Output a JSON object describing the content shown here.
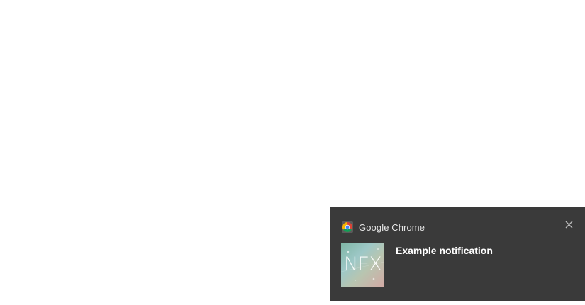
{
  "notification": {
    "app_name": "Google Chrome",
    "app_icon": "chrome-icon",
    "title": "Example notification",
    "thumbnail_text": "NEX",
    "close_icon": "close-icon"
  },
  "colors": {
    "toast_background": "#3a3a3a",
    "desktop_background": "#ffffff",
    "title_text": "#ffffff",
    "app_name_text": "#e6e6e6"
  }
}
